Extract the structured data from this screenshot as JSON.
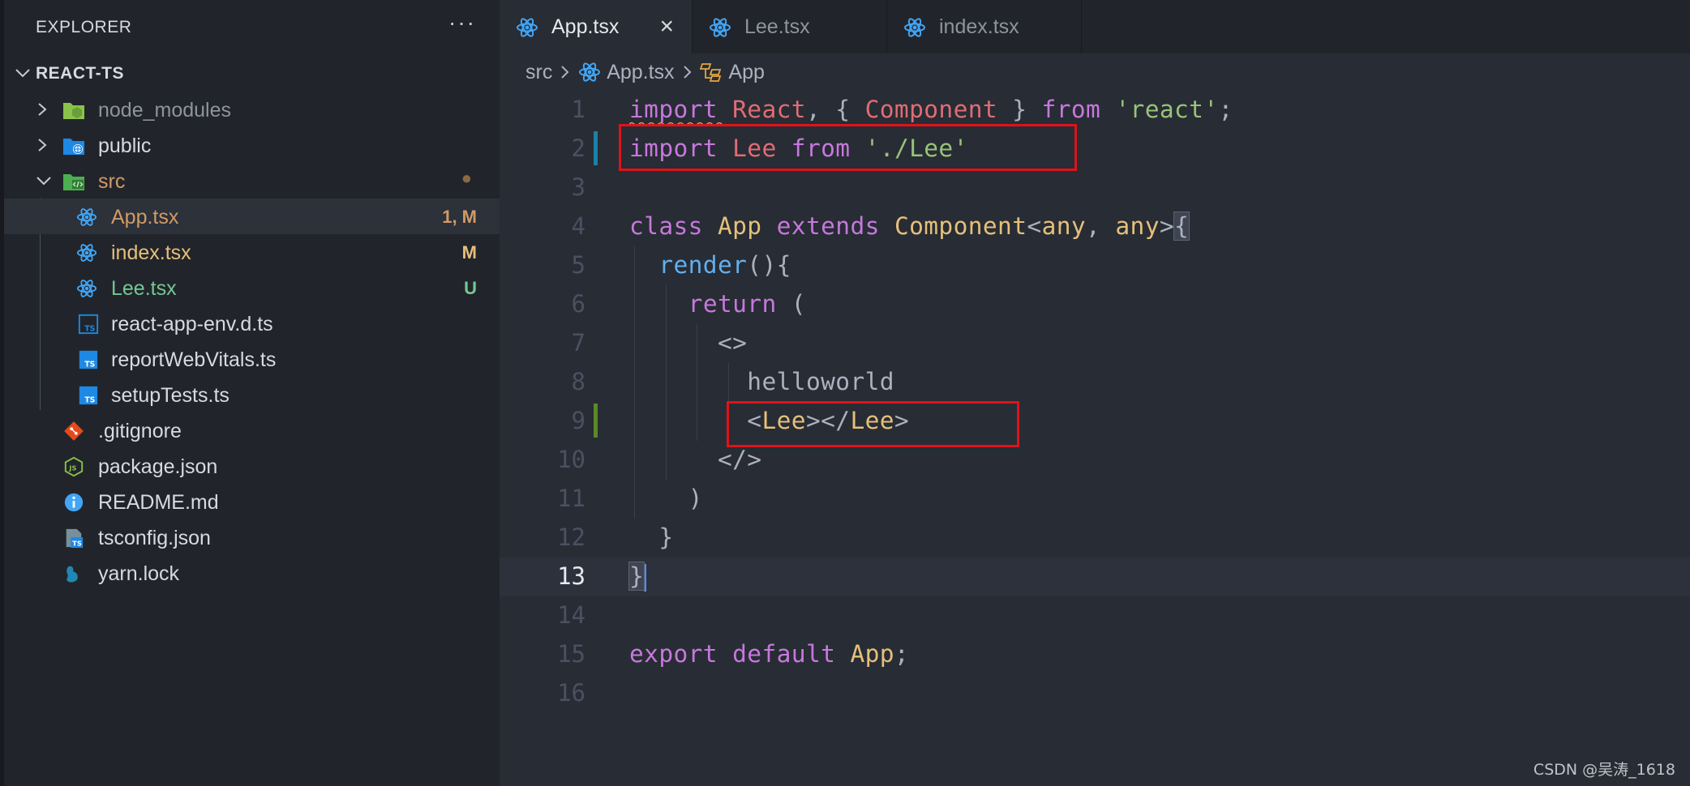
{
  "explorer": {
    "header": "EXPLORER",
    "more": "···",
    "section_title": "REACT-TS",
    "items": [
      {
        "label": "node_modules",
        "badge": ""
      },
      {
        "label": "public",
        "badge": ""
      },
      {
        "label": "src",
        "badge": "●"
      },
      {
        "label": "App.tsx",
        "badge": "1, M"
      },
      {
        "label": "index.tsx",
        "badge": "M"
      },
      {
        "label": "Lee.tsx",
        "badge": "U"
      },
      {
        "label": "react-app-env.d.ts",
        "badge": ""
      },
      {
        "label": "reportWebVitals.ts",
        "badge": ""
      },
      {
        "label": "setupTests.ts",
        "badge": ""
      },
      {
        "label": ".gitignore",
        "badge": ""
      },
      {
        "label": "package.json",
        "badge": ""
      },
      {
        "label": "README.md",
        "badge": ""
      },
      {
        "label": "tsconfig.json",
        "badge": ""
      },
      {
        "label": "yarn.lock",
        "badge": ""
      }
    ]
  },
  "tabs": [
    {
      "label": "App.tsx",
      "close": "×"
    },
    {
      "label": "Lee.tsx"
    },
    {
      "label": "index.tsx"
    }
  ],
  "breadcrumb": {
    "folder": "src",
    "file": "App.tsx",
    "symbol": "App",
    "sep": ">"
  },
  "editor": {
    "line_numbers": [
      "1",
      "2",
      "3",
      "4",
      "5",
      "6",
      "7",
      "8",
      "9",
      "10",
      "11",
      "12",
      "13",
      "14",
      "15",
      "16"
    ],
    "lines": {
      "l1": {
        "kw_import": "import",
        "react": "React",
        "p1": ", { ",
        "component": "Component",
        "p2": " } ",
        "kw_from": "from",
        "space": " ",
        "str": "'react'",
        "semi": ";"
      },
      "l2": {
        "kw_import": "import",
        "lee": "Lee",
        "kw_from": "from",
        "str": "'./Lee'"
      },
      "l4": {
        "kw_class": "class",
        "app": "App",
        "kw_extends": "extends",
        "component": "Component",
        "lt": "<",
        "any1": "any",
        "comma": ", ",
        "any2": "any",
        "gt": ">",
        "brace": "{"
      },
      "l5": {
        "render": "render",
        "paren": "(){"
      },
      "l6": {
        "kw_return": "return",
        "paren": " ("
      },
      "l7": {
        "frag": "<>"
      },
      "l8": {
        "text": "helloworld"
      },
      "l9": {
        "lt1": "<",
        "tag1": "Lee",
        "gt1": "></",
        "tag2": "Lee",
        "gt2": ">"
      },
      "l10": {
        "frag": "</>"
      },
      "l11": {
        "paren": ")"
      },
      "l12": {
        "brace": "}"
      },
      "l13": {
        "brace": "}"
      },
      "l15": {
        "kw_export": "export",
        "kw_default": "default",
        "app": "App",
        "semi": ";"
      }
    }
  },
  "watermark": "CSDN @吴涛_1618",
  "colors": {
    "accent_modified": "#d19a66",
    "untracked": "#73c991",
    "highlight_box": "#e0121b"
  }
}
